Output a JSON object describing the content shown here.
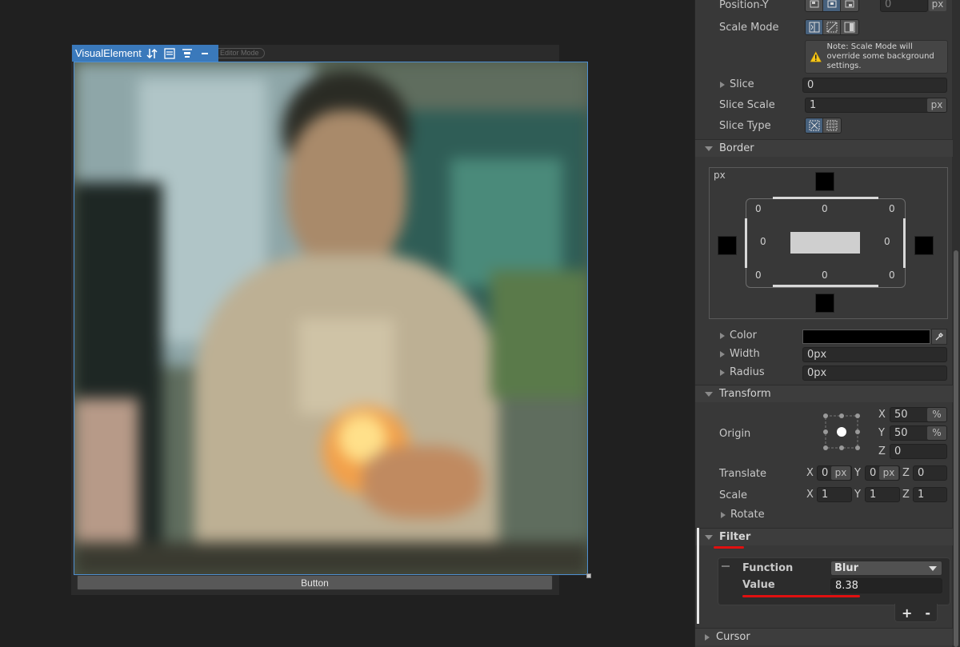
{
  "canvas": {
    "selection_label": "VisualElement",
    "editor_mode_label": "Editor Mode",
    "button_label": "Button"
  },
  "inspector": {
    "position_y": {
      "label": "Position-Y",
      "value": "0",
      "unit": "px"
    },
    "scale_mode": {
      "label": "Scale Mode",
      "note": "Note: Scale Mode will override some background settings.",
      "selected_index": 0
    },
    "slice": {
      "label": "Slice",
      "value": "0"
    },
    "slice_scale": {
      "label": "Slice Scale",
      "value": "1",
      "unit": "px"
    },
    "slice_type": {
      "label": "Slice Type",
      "selected_index": 0
    },
    "border": {
      "title": "Border",
      "unit_label": "px",
      "width_top_left": "0",
      "width_top": "0",
      "width_top_right": "0",
      "width_left": "0",
      "width_right": "0",
      "width_bottom_left": "0",
      "width_bottom": "0",
      "width_bottom_right": "0",
      "color_label": "Color",
      "color_value": "#000000",
      "width_label": "Width",
      "width_value": "0px",
      "radius_label": "Radius",
      "radius_value": "0px"
    },
    "transform": {
      "title": "Transform",
      "origin": {
        "label": "Origin",
        "x_label": "X",
        "x_value": "50",
        "x_unit": "%",
        "y_label": "Y",
        "y_value": "50",
        "y_unit": "%",
        "z_label": "Z",
        "z_value": "0"
      },
      "translate": {
        "label": "Translate",
        "x_label": "X",
        "x_value": "0",
        "x_unit": "px",
        "y_label": "Y",
        "y_value": "0",
        "y_unit": "px",
        "z_label": "Z",
        "z_value": "0"
      },
      "scale": {
        "label": "Scale",
        "x_label": "X",
        "x_value": "1",
        "y_label": "Y",
        "y_value": "1",
        "z_label": "Z",
        "z_value": "1"
      },
      "rotate_label": "Rotate"
    },
    "filter": {
      "title": "Filter",
      "function_label": "Function",
      "function_value": "Blur",
      "value_label": "Value",
      "value_value": "8.38",
      "add_label": "+",
      "remove_label": "-"
    },
    "cursor_title": "Cursor"
  },
  "colors": {
    "selection_blue": "#3a79bb",
    "highlight_red": "#e01010",
    "toggle_on": "#46607c"
  }
}
